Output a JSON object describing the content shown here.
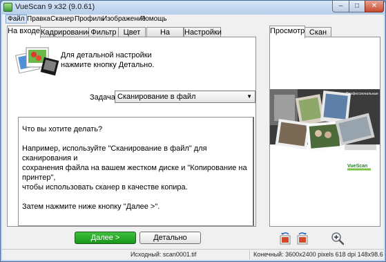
{
  "window": {
    "title": "VueScan 9 x32 (9.0.61)",
    "minimize_glyph": "–",
    "maximize_glyph": "□",
    "close_glyph": "✕"
  },
  "menu": [
    "Файл",
    "Правка",
    "Сканер",
    "Профиль",
    "Изображение",
    "Помощь"
  ],
  "left_tabs": [
    "На входе",
    "Кадрирование",
    "Фильтр",
    "Цвет",
    "На выходе",
    "Настройки"
  ],
  "right_tabs": [
    "Просмотр",
    "Скан"
  ],
  "info": {
    "line1": "Для детальной настройки",
    "line2": "нажмите кнопку Детально."
  },
  "task": {
    "label": "Задача:",
    "value": "Сканирование в файл"
  },
  "help": {
    "question": "Что вы хотите делать?",
    "example_1": "Например, используйте \"Сканирование в файл\" для сканирования и",
    "example_2": "сохранения файла на вашем жестком диске и \"Копирование на принтер\",",
    "example_3": "чтобы использовать сканер в качестве копира.",
    "next_hint": "Затем нажмите ниже кнопку \"Далее >\"."
  },
  "preview": {
    "banner_text": "Профессиональные",
    "logo_text": "VueScan"
  },
  "buttons": {
    "next": "Далее >",
    "detail": "Детально"
  },
  "status": {
    "source": "Исходный: scan0001.tif",
    "output": "Конечный: 3600x2400 pixels 618 dpi 148x98.6 mm 2..."
  },
  "colors": {
    "next_button": "#189618",
    "logo_green": "#7ac143"
  }
}
